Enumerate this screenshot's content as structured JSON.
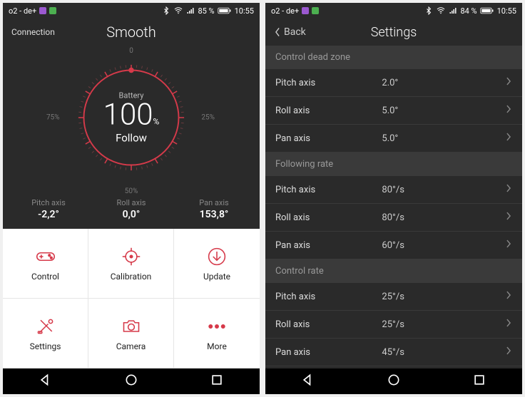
{
  "left": {
    "status": {
      "carrier": "o2 - de+",
      "battery": "85 %",
      "time": "10:55"
    },
    "connection": "Connection",
    "title": "Smooth",
    "gauge": {
      "battery_label": "Battery",
      "value": "100",
      "percent_symbol": "%",
      "mode": "Follow",
      "ticks": {
        "t0": "0",
        "t25": "25%",
        "t50": "50%",
        "t75": "75%"
      }
    },
    "axes": {
      "pitch": {
        "label": "Pitch axis",
        "value": "-2,2°"
      },
      "roll": {
        "label": "Roll axis",
        "value": "0,0°"
      },
      "pan": {
        "label": "Pan axis",
        "value": "153,8°"
      }
    },
    "actions": [
      {
        "label": "Control",
        "name": "control"
      },
      {
        "label": "Calibration",
        "name": "calibration"
      },
      {
        "label": "Update",
        "name": "update"
      },
      {
        "label": "Settings",
        "name": "settings"
      },
      {
        "label": "Camera",
        "name": "camera"
      },
      {
        "label": "More",
        "name": "more"
      }
    ]
  },
  "right": {
    "status": {
      "carrier": "o2 - de+",
      "battery": "84 %",
      "time": "10:55"
    },
    "back": "Back",
    "title": "Settings",
    "sections": [
      {
        "title": "Control dead zone",
        "rows": [
          {
            "label": "Pitch axis",
            "value": "2.0°"
          },
          {
            "label": "Roll axis",
            "value": "5.0°"
          },
          {
            "label": "Pan axis",
            "value": "5.0°"
          }
        ]
      },
      {
        "title": "Following rate",
        "rows": [
          {
            "label": "Pitch axis",
            "value": "80°/s"
          },
          {
            "label": "Roll axis",
            "value": "80°/s"
          },
          {
            "label": "Pan axis",
            "value": "60°/s"
          }
        ]
      },
      {
        "title": "Control rate",
        "rows": [
          {
            "label": "Pitch axis",
            "value": "25°/s"
          },
          {
            "label": "Roll axis",
            "value": "25°/s"
          },
          {
            "label": "Pan axis",
            "value": "45°/s"
          }
        ]
      }
    ]
  }
}
